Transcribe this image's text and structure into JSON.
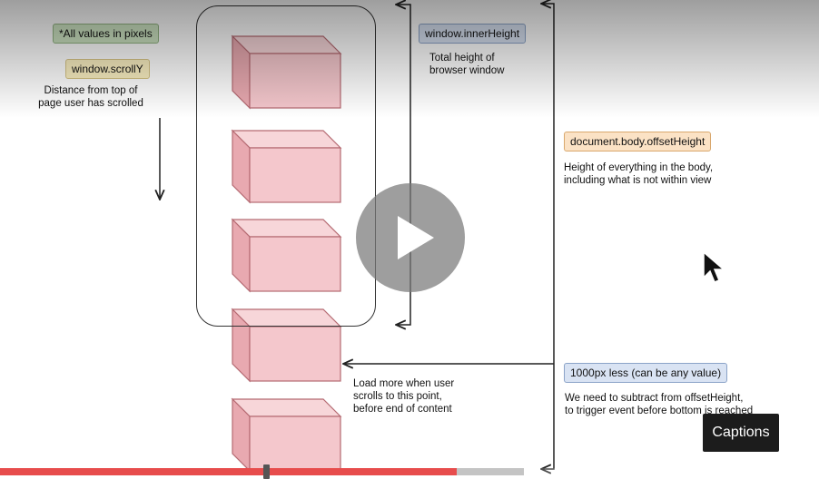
{
  "labels": {
    "all_values": "*All values in pixels",
    "scroll_y": "window.scrollY",
    "scroll_y_desc_1": "Distance from top of",
    "scroll_y_desc_2": "page user has scrolled",
    "inner_height": "window.innerHeight",
    "inner_height_desc_1": "Total height of",
    "inner_height_desc_2": "browser window",
    "offset_height": "document.body.offsetHeight",
    "offset_height_desc_1": "Height of everything in the body,",
    "offset_height_desc_2": "including what is not within view",
    "less_1000": "1000px less (can be any value)",
    "less_desc_1": "We need to subtract from offsetHeight,",
    "less_desc_2": "to trigger event before bottom is reached",
    "load_more_1": "Load more when user",
    "load_more_2": "scrolls to this point,",
    "load_more_3": "before end of content"
  },
  "player": {
    "captions_label": "Captions",
    "progress_played": 0.558,
    "progress_buffered": 0.64,
    "marker_position": 0.321
  },
  "colors": {
    "box_fill": "#f4c7cc",
    "box_stroke": "#b56a72",
    "progress_played": "#e74c4c"
  }
}
